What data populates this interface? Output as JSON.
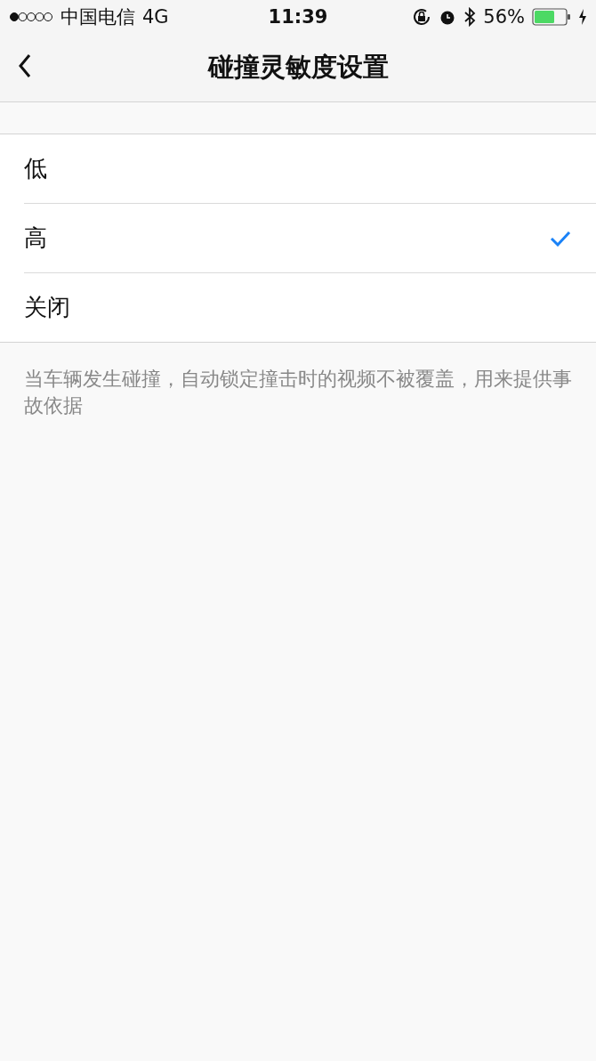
{
  "status_bar": {
    "carrier": "中国电信",
    "network": "4G",
    "time": "11:39",
    "battery": "56%"
  },
  "nav": {
    "title": "碰撞灵敏度设置"
  },
  "options": [
    {
      "label": "低",
      "selected": false
    },
    {
      "label": "高",
      "selected": true
    },
    {
      "label": "关闭",
      "selected": false
    }
  ],
  "footer": "当车辆发生碰撞，自动锁定撞击时的视频不被覆盖，用来提供事故依据"
}
